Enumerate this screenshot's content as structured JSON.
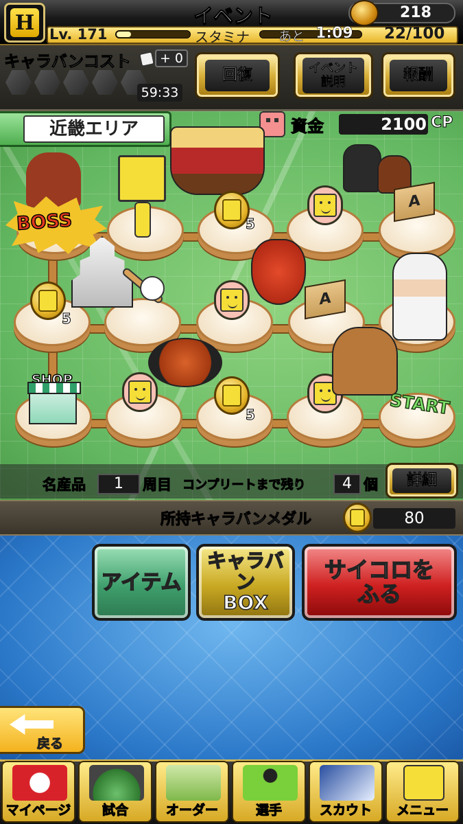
{
  "header": {
    "title": "イベント",
    "coins": "218",
    "level": "Lv. 171",
    "exp_fraction": 0.2,
    "stamina_label": "スタミナ",
    "stamina_remain_label": "あと",
    "stamina_timer": "1:09",
    "stamina_value": "22/100"
  },
  "caravan_cost": {
    "title": "キャラバンコスト",
    "plus": "+ 0",
    "timer": "59:33",
    "slots_filled": 0,
    "slots_total": 5
  },
  "buttons": {
    "recover": "回復",
    "event_line1": "イベント",
    "event_line2": "説明",
    "reward": "報酬",
    "detail": "詳細",
    "item": "アイテム",
    "box_line1": "キャラバン",
    "box_line2": "BOX",
    "roll_line1": "サイコロを",
    "roll_line2": "ふる",
    "back": "戻る"
  },
  "map": {
    "area_name": "近畿エリア",
    "funds_label": "資金",
    "funds_value": "2100",
    "funds_unit": "CP",
    "boss_label": "BOSS",
    "shop_label": "SHOP",
    "start_label": "START",
    "coin_count": "5",
    "box_letter": "A"
  },
  "progress": {
    "specialty_label": "名産品",
    "lap": "1",
    "lap_label": "周目",
    "remaining_label": "コンプリートまで残り",
    "remaining": "4",
    "unit_label": "個"
  },
  "medal": {
    "label": "所持キャラバンメダル",
    "value": "80"
  },
  "nav": [
    {
      "label": "マイページ",
      "icon": "mypage-icon",
      "color": "#d8222a"
    },
    {
      "label": "試合",
      "icon": "stadium-icon",
      "color": "#3a8a3a"
    },
    {
      "label": "オーダー",
      "icon": "order-icon",
      "color": "#9acb6a"
    },
    {
      "label": "選手",
      "icon": "player-icon",
      "color": "#7ad03a"
    },
    {
      "label": "スカウト",
      "icon": "scout-icon",
      "color": "#e8f0ff"
    },
    {
      "label": "メニュー",
      "icon": "menu-icon",
      "color": "#f6de38"
    }
  ]
}
